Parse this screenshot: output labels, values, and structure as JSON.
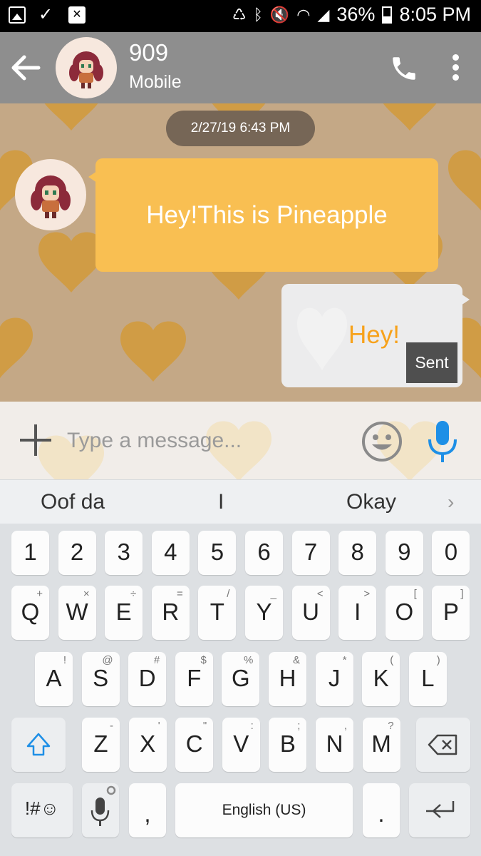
{
  "status_bar": {
    "battery": "36%",
    "time": "8:05 PM",
    "battery_level": 0.36
  },
  "header": {
    "contact_name": "909",
    "contact_type": "Mobile"
  },
  "conversation": {
    "date": "2/27/19 6:43 PM",
    "incoming_message": "Hey!This is Pineapple",
    "outgoing_message": "Hey!",
    "outgoing_status": "Sent"
  },
  "composer": {
    "placeholder": "Type a message..."
  },
  "suggestions": [
    "Oof da",
    "I",
    "Okay"
  ],
  "keyboard": {
    "number_row": [
      "1",
      "2",
      "3",
      "4",
      "5",
      "6",
      "7",
      "8",
      "9",
      "0"
    ],
    "row1": [
      {
        "key": "Q",
        "sup": "+"
      },
      {
        "key": "W",
        "sup": "×"
      },
      {
        "key": "E",
        "sup": "÷"
      },
      {
        "key": "R",
        "sup": "="
      },
      {
        "key": "T",
        "sup": "/"
      },
      {
        "key": "Y",
        "sup": "_"
      },
      {
        "key": "U",
        "sup": "<"
      },
      {
        "key": "I",
        "sup": ">"
      },
      {
        "key": "O",
        "sup": "["
      },
      {
        "key": "P",
        "sup": "]"
      }
    ],
    "row2": [
      {
        "key": "A",
        "sup": "!"
      },
      {
        "key": "S",
        "sup": "@"
      },
      {
        "key": "D",
        "sup": "#"
      },
      {
        "key": "F",
        "sup": "$"
      },
      {
        "key": "G",
        "sup": "%"
      },
      {
        "key": "H",
        "sup": "&"
      },
      {
        "key": "J",
        "sup": "*"
      },
      {
        "key": "K",
        "sup": "("
      },
      {
        "key": "L",
        "sup": ")"
      }
    ],
    "row3": [
      {
        "key": "Z",
        "sup": "-"
      },
      {
        "key": "X",
        "sup": "'"
      },
      {
        "key": "C",
        "sup": "\""
      },
      {
        "key": "V",
        "sup": ":"
      },
      {
        "key": "B",
        "sup": ";"
      },
      {
        "key": "N",
        "sup": ","
      },
      {
        "key": "M",
        "sup": "?"
      }
    ],
    "symbols_label": "!#☺",
    "comma": ",",
    "space_label": "English (US)",
    "period": "."
  },
  "colors": {
    "app_bar": "#8e8e8e",
    "chat_background": "#c4a886",
    "heart": "#d39a3a",
    "incoming_bubble": "#f9bf52",
    "outgoing_text": "#f7a21b",
    "mic_accent": "#1e8fe6"
  },
  "icons": {
    "back": "back-arrow-icon",
    "call": "phone-icon",
    "more": "more-vert-icon",
    "attach": "plus-icon",
    "emoji": "emoji-icon",
    "voice": "microphone-icon",
    "shift": "shift-icon",
    "delete": "backspace-icon",
    "enter": "enter-icon",
    "voice_input": "microphone-settings-icon"
  }
}
